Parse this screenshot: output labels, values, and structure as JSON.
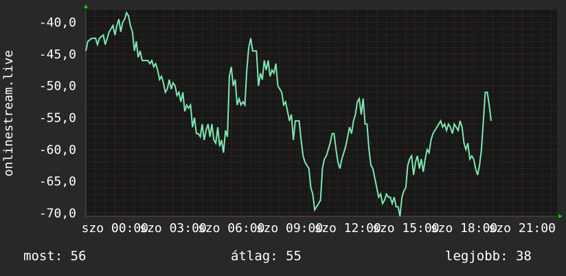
{
  "chart_data": {
    "type": "line",
    "ylabel": "onlinestream.live",
    "ylim": [
      -70.5,
      -38.0
    ],
    "y_ticks": [
      -70,
      -65,
      -60,
      -55,
      -50,
      -45,
      -40
    ],
    "y_tick_labels": [
      "-70,0",
      "-65,0",
      "-60,0",
      "-55,0",
      "-50,0",
      "-45,0",
      "-40,0"
    ],
    "x_tick_labels": [
      "szo 00:00",
      "szo 03:00",
      "szo 06:00",
      "szo 09:00",
      "szo 12:00",
      "szo 15:00",
      "szo 18:00",
      "szo 21:00"
    ],
    "x_tick_hours": [
      0,
      3,
      6,
      9,
      12,
      15,
      18,
      21
    ],
    "xlim_hours": [
      -1.5,
      22.8
    ],
    "grid": true,
    "colors": {
      "background": "#282828",
      "plot": "#181818",
      "line": "#7ee8b2",
      "grid_major": "#8a2020",
      "grid_minor": "#3a3a3a",
      "axis_arrow": "#00d000"
    },
    "series": [
      {
        "points": [
          [
            -1.5,
            -44.5
          ],
          [
            -1.4,
            -43.0
          ],
          [
            -1.2,
            -42.5
          ],
          [
            -1.0,
            -42.5
          ],
          [
            -0.9,
            -43.5
          ],
          [
            -0.8,
            -42.5
          ],
          [
            -0.6,
            -42.0
          ],
          [
            -0.5,
            -43.5
          ],
          [
            -0.4,
            -42.5
          ],
          [
            -0.3,
            -41.5
          ],
          [
            -0.1,
            -40.5
          ],
          [
            0.0,
            -42.0
          ],
          [
            0.1,
            -40.5
          ],
          [
            0.2,
            -39.5
          ],
          [
            0.3,
            -41.5
          ],
          [
            0.4,
            -40.0
          ],
          [
            0.5,
            -39.5
          ],
          [
            0.6,
            -38.5
          ],
          [
            0.7,
            -39.0
          ],
          [
            0.8,
            -40.5
          ],
          [
            0.9,
            -41.5
          ],
          [
            1.0,
            -44.5
          ],
          [
            1.1,
            -43.0
          ],
          [
            1.2,
            -45.5
          ],
          [
            1.3,
            -44.5
          ],
          [
            1.4,
            -46.0
          ],
          [
            1.5,
            -46.0
          ],
          [
            1.7,
            -46.0
          ],
          [
            1.8,
            -46.5
          ],
          [
            1.9,
            -46.0
          ],
          [
            2.0,
            -47.0
          ],
          [
            2.1,
            -46.5
          ],
          [
            2.2,
            -47.5
          ],
          [
            2.3,
            -49.0
          ],
          [
            2.4,
            -48.5
          ],
          [
            2.5,
            -49.5
          ],
          [
            2.6,
            -51.0
          ],
          [
            2.7,
            -50.5
          ],
          [
            2.8,
            -49.0
          ],
          [
            2.9,
            -50.5
          ],
          [
            3.0,
            -49.5
          ],
          [
            3.1,
            -50.0
          ],
          [
            3.2,
            -51.5
          ],
          [
            3.3,
            -51.0
          ],
          [
            3.4,
            -52.5
          ],
          [
            3.5,
            -51.0
          ],
          [
            3.6,
            -54.0
          ],
          [
            3.7,
            -53.0
          ],
          [
            3.8,
            -53.5
          ],
          [
            3.9,
            -53.0
          ],
          [
            4.0,
            -56.5
          ],
          [
            4.1,
            -55.0
          ],
          [
            4.2,
            -57.5
          ],
          [
            4.3,
            -57.5
          ],
          [
            4.4,
            -58.0
          ],
          [
            4.5,
            -56.0
          ],
          [
            4.6,
            -58.5
          ],
          [
            4.7,
            -57.0
          ],
          [
            4.8,
            -56.0
          ],
          [
            4.9,
            -58.0
          ],
          [
            5.0,
            -56.0
          ],
          [
            5.1,
            -58.5
          ],
          [
            5.2,
            -59.0
          ],
          [
            5.3,
            -56.5
          ],
          [
            5.4,
            -59.5
          ],
          [
            5.5,
            -58.5
          ],
          [
            5.6,
            -60.5
          ],
          [
            5.7,
            -57.0
          ],
          [
            5.8,
            -58.0
          ],
          [
            5.9,
            -48.5
          ],
          [
            6.0,
            -47.0
          ],
          [
            6.1,
            -50.0
          ],
          [
            6.2,
            -49.0
          ],
          [
            6.3,
            -53.0
          ],
          [
            6.4,
            -52.0
          ],
          [
            6.5,
            -53.0
          ],
          [
            6.6,
            -52.5
          ],
          [
            6.7,
            -53.0
          ],
          [
            6.8,
            -47.5
          ],
          [
            6.9,
            -44.0
          ],
          [
            7.0,
            -42.5
          ],
          [
            7.1,
            -44.5
          ],
          [
            7.3,
            -44.5
          ],
          [
            7.4,
            -50.0
          ],
          [
            7.5,
            -48.0
          ],
          [
            7.6,
            -49.0
          ],
          [
            7.7,
            -46.0
          ],
          [
            7.8,
            -47.5
          ],
          [
            7.9,
            -46.0
          ],
          [
            8.0,
            -48.5
          ],
          [
            8.1,
            -47.5
          ],
          [
            8.2,
            -48.0
          ],
          [
            8.3,
            -46.5
          ],
          [
            8.4,
            -50.0
          ],
          [
            8.5,
            -50.5
          ],
          [
            8.6,
            -51.0
          ],
          [
            8.7,
            -53.0
          ],
          [
            8.8,
            -52.5
          ],
          [
            8.9,
            -54.0
          ],
          [
            9.0,
            -55.5
          ],
          [
            9.1,
            -54.5
          ],
          [
            9.2,
            -58.5
          ],
          [
            9.3,
            -55.5
          ],
          [
            9.5,
            -55.5
          ],
          [
            9.6,
            -58.5
          ],
          [
            9.7,
            -61.0
          ],
          [
            9.8,
            -62.0
          ],
          [
            9.9,
            -62.5
          ],
          [
            10.0,
            -63.0
          ],
          [
            10.1,
            -66.0
          ],
          [
            10.2,
            -67.0
          ],
          [
            10.3,
            -69.5
          ],
          [
            10.4,
            -69.0
          ],
          [
            10.5,
            -68.5
          ],
          [
            10.6,
            -68.0
          ],
          [
            10.7,
            -63.0
          ],
          [
            10.8,
            -61.5
          ],
          [
            10.9,
            -61.0
          ],
          [
            11.0,
            -60.0
          ],
          [
            11.1,
            -59.0
          ],
          [
            11.2,
            -57.5
          ],
          [
            11.3,
            -57.5
          ],
          [
            11.4,
            -60.0
          ],
          [
            11.5,
            -62.0
          ],
          [
            11.6,
            -63.0
          ],
          [
            11.7,
            -61.5
          ],
          [
            11.8,
            -60.5
          ],
          [
            11.9,
            -59.5
          ],
          [
            12.0,
            -58.0
          ],
          [
            12.1,
            -56.5
          ],
          [
            12.2,
            -57.5
          ],
          [
            12.3,
            -55.5
          ],
          [
            12.4,
            -54.5
          ],
          [
            12.5,
            -52.5
          ],
          [
            12.6,
            -52.0
          ],
          [
            12.7,
            -54.5
          ],
          [
            12.8,
            -52.0
          ],
          [
            12.9,
            -56.0
          ],
          [
            13.0,
            -56.0
          ],
          [
            13.1,
            -60.0
          ],
          [
            13.2,
            -62.5
          ],
          [
            13.3,
            -63.0
          ],
          [
            13.4,
            -64.5
          ],
          [
            13.5,
            -66.0
          ],
          [
            13.6,
            -67.5
          ],
          [
            13.7,
            -67.0
          ],
          [
            13.8,
            -68.5
          ],
          [
            13.9,
            -68.0
          ],
          [
            14.0,
            -67.0
          ],
          [
            14.1,
            -67.5
          ],
          [
            14.2,
            -67.5
          ],
          [
            14.3,
            -68.5
          ],
          [
            14.4,
            -67.5
          ],
          [
            14.5,
            -69.0
          ],
          [
            14.6,
            -69.0
          ],
          [
            14.7,
            -70.5
          ],
          [
            14.8,
            -67.5
          ],
          [
            14.9,
            -66.5
          ],
          [
            15.0,
            -66.0
          ],
          [
            15.1,
            -62.5
          ],
          [
            15.2,
            -61.5
          ],
          [
            15.3,
            -61.0
          ],
          [
            15.4,
            -64.0
          ],
          [
            15.5,
            -62.0
          ],
          [
            15.6,
            -61.0
          ],
          [
            15.7,
            -63.0
          ],
          [
            15.8,
            -61.5
          ],
          [
            15.9,
            -63.5
          ],
          [
            16.0,
            -61.5
          ],
          [
            16.1,
            -60.0
          ],
          [
            16.2,
            -60.5
          ],
          [
            16.3,
            -58.5
          ],
          [
            16.4,
            -57.5
          ],
          [
            16.5,
            -57.0
          ],
          [
            16.6,
            -56.5
          ],
          [
            16.7,
            -56.0
          ],
          [
            16.8,
            -55.5
          ],
          [
            16.9,
            -56.5
          ],
          [
            17.0,
            -56.0
          ],
          [
            17.1,
            -57.0
          ],
          [
            17.2,
            -56.0
          ],
          [
            17.3,
            -56.5
          ],
          [
            17.4,
            -57.5
          ],
          [
            17.5,
            -56.0
          ],
          [
            17.6,
            -56.5
          ],
          [
            17.7,
            -57.0
          ],
          [
            17.8,
            -55.5
          ],
          [
            17.9,
            -56.5
          ],
          [
            18.0,
            -59.0
          ],
          [
            18.1,
            -60.0
          ],
          [
            18.2,
            -59.0
          ],
          [
            18.3,
            -61.5
          ],
          [
            18.4,
            -61.0
          ],
          [
            18.5,
            -61.5
          ],
          [
            18.6,
            -63.0
          ],
          [
            18.7,
            -64.0
          ],
          [
            18.8,
            -62.5
          ],
          [
            18.9,
            -60.0
          ],
          [
            19.0,
            -55.5
          ],
          [
            19.1,
            -51.0
          ],
          [
            19.2,
            -51.0
          ],
          [
            19.3,
            -53.0
          ],
          [
            19.4,
            -55.5
          ]
        ]
      }
    ]
  },
  "stats": {
    "current": "most: 56",
    "average": "átlag: 55",
    "best": "legjobb: 38"
  }
}
